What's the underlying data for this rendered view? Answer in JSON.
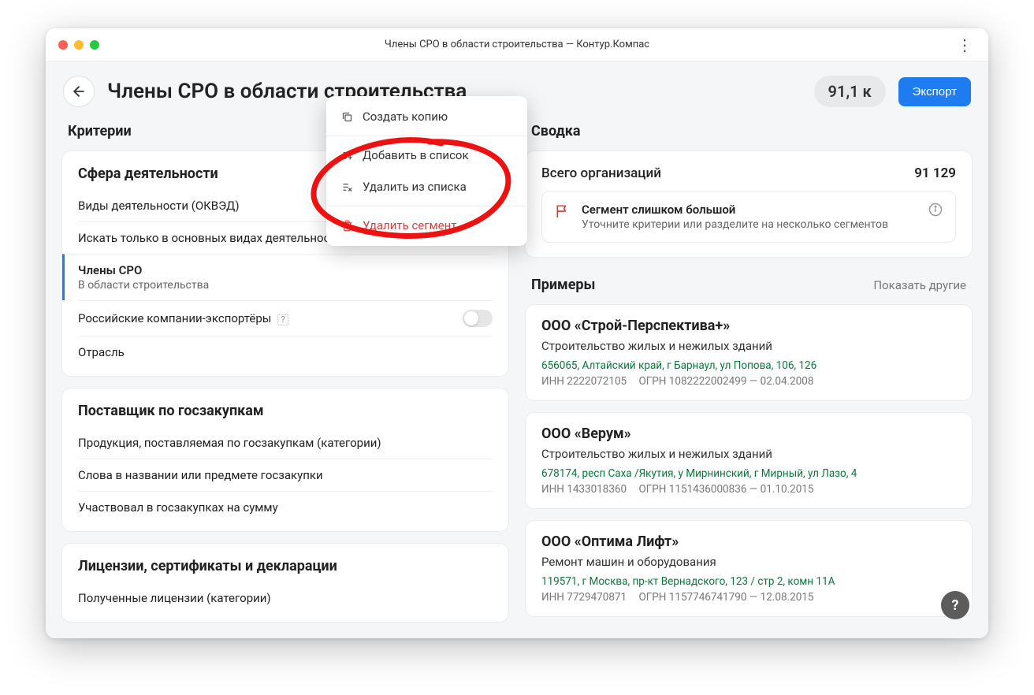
{
  "window_title": "Члены СРО в области строительства — Контур.Компас",
  "header": {
    "page_title": "Члены СРО в области строительства",
    "count_pill": "91,1 к",
    "export_label": "Экспорт"
  },
  "left": {
    "heading": "Критерии",
    "group1": {
      "title": "Сфера деятельности",
      "rows": {
        "r1": "Виды деятельности (ОКВЭД)",
        "r2": "Искать только в основных видах деятельности",
        "r3_label": "Члены СРО",
        "r3_sub": "В области строительства",
        "r4": "Российские компании-экспортёры",
        "r5": "Отрасль"
      }
    },
    "group2": {
      "title": "Поставщик по госзакупкам",
      "rows": {
        "r1": "Продукция, поставляемая по госзакупкам (категории)",
        "r2": "Слова в названии или предмете госзакупки",
        "r3": "Участвовал в госзакупках на сумму"
      }
    },
    "group3": {
      "title": "Лицензии, сертификаты и декларации",
      "rows": {
        "r1": "Полученные лицензии (категории)"
      }
    }
  },
  "right": {
    "heading": "Сводка",
    "summary": {
      "label": "Всего организаций",
      "value": "91 129",
      "alert_title": "Сегмент слишком большой",
      "alert_desc": "Уточните критерии или разделите на несколько сегментов"
    },
    "examples_heading": "Примеры",
    "examples_link": "Показать другие",
    "examples": [
      {
        "name": "ООО «Строй-Перспектива+»",
        "activity": "Строительство жилых и нежилых зданий",
        "address": "656065, Алтайский край, г Барнаул, ул Попова, 106, 126",
        "inn": "ИНН 2222072105",
        "ogrn": "ОГРН 1082222002499 — 02.04.2008"
      },
      {
        "name": "ООО «Верум»",
        "activity": "Строительство жилых и нежилых зданий",
        "address": "678174, респ Саха /Якутия, у Мирнинский, г Мирный, ул Лазо, 4",
        "inn": "ИНН 1433018360",
        "ogrn": "ОГРН 1151436000836 — 01.10.2015"
      },
      {
        "name": "ООО «Оптима Лифт»",
        "activity": "Ремонт машин и оборудования",
        "address": "119571, г Москва, пр-кт Вернадского, 123 / стр 2, комн 11А",
        "inn": "ИНН 7729470871",
        "ogrn": "ОГРН 1157746741790 — 12.08.2015"
      }
    ]
  },
  "popover": {
    "create_copy": "Создать копию",
    "add_to_list": "Добавить в список",
    "remove_from_list": "Удалить из списка",
    "delete_segment": "Удалить сегмент"
  },
  "help_fab": "?"
}
